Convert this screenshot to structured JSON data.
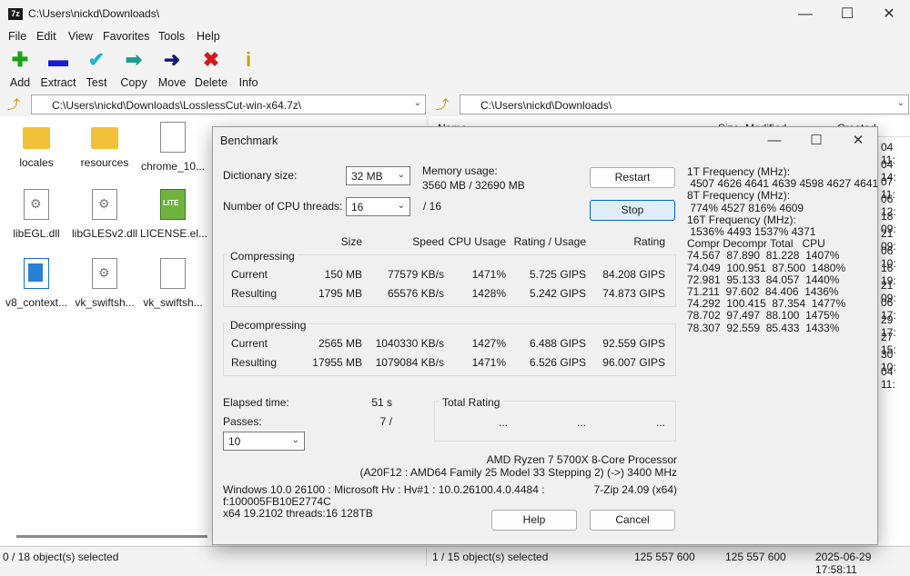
{
  "window": {
    "title": "C:\\Users\\nickd\\Downloads\\",
    "app_badge": "7z"
  },
  "menu": [
    "File",
    "Edit",
    "View",
    "Favorites",
    "Tools",
    "Help"
  ],
  "toolbar": [
    {
      "label": "Add",
      "icon": "plus-icon",
      "color": "#1aa31a"
    },
    {
      "label": "Extract",
      "icon": "minus-icon",
      "color": "#1b1bd1"
    },
    {
      "label": "Test",
      "icon": "check-icon",
      "color": "#1fb6c9"
    },
    {
      "label": "Copy",
      "icon": "copy-arrow-icon",
      "color": "#1d9d8f"
    },
    {
      "label": "Move",
      "icon": "move-arrow-icon",
      "color": "#18187a"
    },
    {
      "label": "Delete",
      "icon": "delete-x-icon",
      "color": "#d21b1b"
    },
    {
      "label": "Info",
      "icon": "info-icon",
      "color": "#d2a100"
    }
  ],
  "left_address": "C:\\Users\\nickd\\Downloads\\LosslessCut-win-x64.7z\\",
  "right_address": "C:\\Users\\nickd\\Downloads\\",
  "left_files": [
    {
      "name": "locales",
      "type": "folder"
    },
    {
      "name": "resources",
      "type": "folder"
    },
    {
      "name": "chrome_10...",
      "type": "doc"
    },
    {
      "name": "libEGL.dll",
      "type": "dll"
    },
    {
      "name": "libGLESv2.dll",
      "type": "dll"
    },
    {
      "name": "LICENSE.el...",
      "type": "lite"
    },
    {
      "name": "v8_context...",
      "type": "v8"
    },
    {
      "name": "vk_swiftsh...",
      "type": "dll"
    },
    {
      "name": "vk_swiftsh...",
      "type": "doc"
    }
  ],
  "right_headers": {
    "name": "Name",
    "size": "Size",
    "modified": "Modified",
    "created": "Created"
  },
  "right_dates": [
    "04 11:",
    "04 14:",
    "07 11:",
    "06 12:",
    "18 09:",
    "21 09:",
    "06 10:",
    "16 19:",
    "21 09:",
    "06 17:",
    "29 17:",
    "27 15:",
    "30 10:",
    "04 11:"
  ],
  "status": {
    "left": "0 / 18 object(s) selected",
    "right": "1 / 15 object(s) selected",
    "size1": "125 557 600",
    "size2": "125 557 600",
    "datetime": "2025-06-29 17:58:11"
  },
  "benchmark": {
    "title": "Benchmark",
    "dict_label": "Dictionary size:",
    "dict_value": "32 MB",
    "threads_label": "Number of CPU threads:",
    "threads_value": "16",
    "threads_total": "/ 16",
    "mem_label": "Memory usage:",
    "mem_value": "3560 MB / 32690 MB",
    "restart": "Restart",
    "stop": "Stop",
    "headers": [
      "Size",
      "Speed",
      "CPU Usage",
      "Rating / Usage",
      "Rating"
    ],
    "compress_title": "Compressing",
    "compress_rows": [
      {
        "label": "Current",
        "size": "150 MB",
        "speed": "77579 KB/s",
        "cpu": "1471%",
        "ru": "5.725 GIPS",
        "rating": "84.208 GIPS"
      },
      {
        "label": "Resulting",
        "size": "1795 MB",
        "speed": "65576 KB/s",
        "cpu": "1428%",
        "ru": "5.242 GIPS",
        "rating": "74.873 GIPS"
      }
    ],
    "decompress_title": "Decompressing",
    "decompress_rows": [
      {
        "label": "Current",
        "size": "2565 MB",
        "speed": "1040330 KB/s",
        "cpu": "1427%",
        "ru": "6.488 GIPS",
        "rating": "92.559 GIPS"
      },
      {
        "label": "Resulting",
        "size": "17955 MB",
        "speed": "1079084 KB/s",
        "cpu": "1471%",
        "ru": "6.526 GIPS",
        "rating": "96.007 GIPS"
      }
    ],
    "elapsed_label": "Elapsed time:",
    "elapsed_value": "51 s",
    "passes_label": "Passes:",
    "passes_value": "7 /",
    "passes_combo": "10",
    "total_rating_title": "Total Rating",
    "total_dots": [
      "...",
      "...",
      "..."
    ],
    "cpu_name": "AMD Ryzen 7 5700X 8-Core Processor",
    "cpu_detail": "(A20F12 : AMD64 Family 25 Model 33 Stepping 2) (->) 3400 MHz",
    "os_line1": "Windows 10.0 26100 : Microsoft Hv : Hv#1 : 10.0.26100.4.0.4484 :",
    "os_line2": "f:100005FB10E2774C",
    "os_line3": "x64 19.2102 threads:16 128TB",
    "version": "7-Zip 24.09 (x64)",
    "help": "Help",
    "cancel": "Cancel",
    "freq_lines": [
      "1T Frequency (MHz):",
      " 4507 4626 4641 4639 4598 4627 4641",
      "8T Frequency (MHz):",
      " 774% 4527 816% 4609",
      "16T Frequency (MHz):",
      " 1536% 4493 1537% 4371",
      "Compr Decompr Total   CPU",
      "74.567  87.890  81.228  1407%",
      "74.049  100.951  87.500  1480%",
      "72.981  95.133  84.057  1440%",
      "71.211  97.602  84.406  1436%",
      "74.292  100.415  87.354  1477%",
      "78.702  97.497  88.100  1475%",
      "78.307  92.559  85.433  1433%"
    ]
  }
}
